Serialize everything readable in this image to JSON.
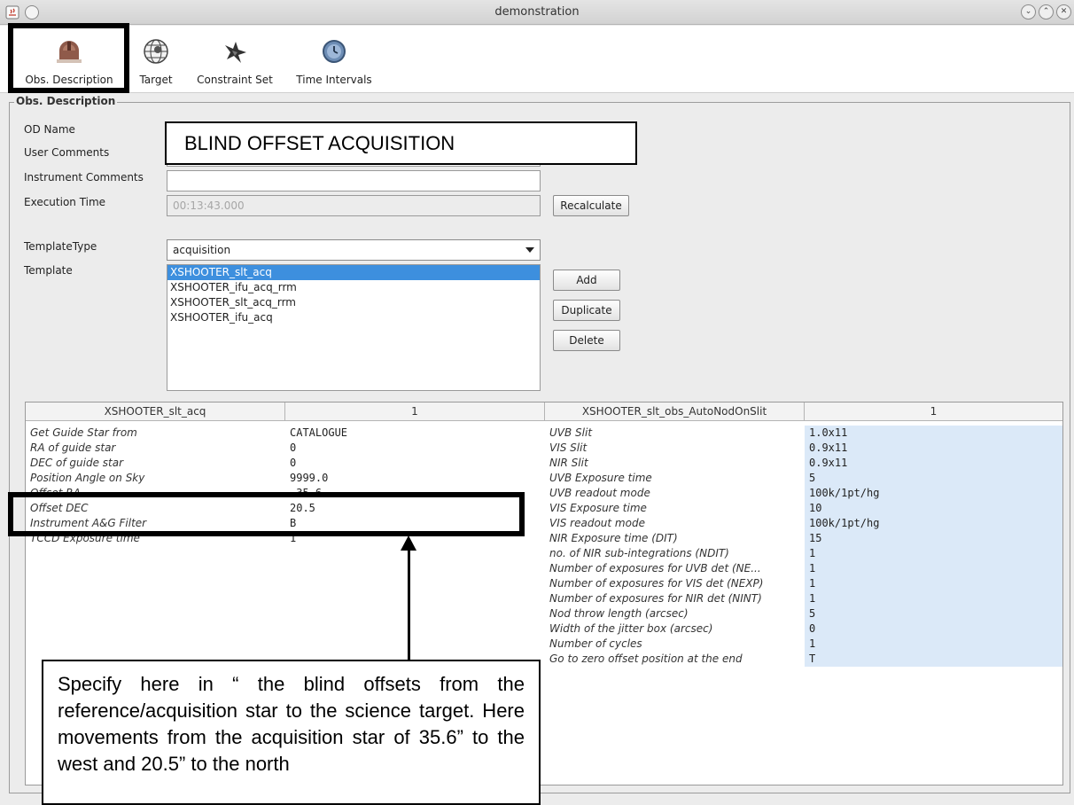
{
  "window": {
    "title": "demonstration",
    "controls": [
      "minimize",
      "maximize",
      "close"
    ]
  },
  "toolbar": {
    "tabs": [
      {
        "label": "Obs. Description",
        "icon": "telescope-dome-icon"
      },
      {
        "label": "Target",
        "icon": "globe-icon"
      },
      {
        "label": "Constraint Set",
        "icon": "star-icon"
      },
      {
        "label": "Time Intervals",
        "icon": "clock-icon"
      }
    ]
  },
  "obs": {
    "group_title": "Obs. Description",
    "labels": {
      "od_name": "OD Name",
      "user_comments": "User Comments",
      "instrument_comments": "Instrument Comments",
      "execution_time": "Execution Time",
      "template_type": "TemplateType",
      "template": "Template"
    },
    "od_name_value": "",
    "user_comments_value": "",
    "instrument_comments_value": "",
    "execution_time_value": "00:13:43.000",
    "recalculate_label": "Recalculate",
    "template_type_value": "acquisition",
    "templates": [
      "XSHOOTER_slt_acq",
      "XSHOOTER_ifu_acq_rrm",
      "XSHOOTER_slt_acq_rrm",
      "XSHOOTER_ifu_acq"
    ],
    "add_label": "Add",
    "duplicate_label": "Duplicate",
    "delete_label": "Delete"
  },
  "annotation": {
    "title_callout": "BLIND OFFSET ACQUISITION",
    "note": "Specify here in “ the blind offsets from the reference/acquisition star to the science target. Here movements from the acquisition star of 35.6” to the west and 20.5” to the north"
  },
  "params": {
    "headers": [
      "XSHOOTER_slt_acq",
      "1",
      "XSHOOTER_slt_obs_AutoNodOnSlit",
      "1"
    ],
    "left": [
      {
        "name": "Get Guide Star from",
        "value": "CATALOGUE"
      },
      {
        "name": "RA of guide star",
        "value": "0"
      },
      {
        "name": "DEC of guide star",
        "value": "0"
      },
      {
        "name": "Position Angle on Sky",
        "value": "9999.0"
      },
      {
        "name": "Offset RA",
        "value": "-35.6"
      },
      {
        "name": "Offset DEC",
        "value": "20.5"
      },
      {
        "name": "Instrument A&G Filter",
        "value": "B"
      },
      {
        "name": "TCCD Exposure time",
        "value": "1"
      }
    ],
    "right": [
      {
        "name": "UVB Slit",
        "value": "1.0x11"
      },
      {
        "name": "VIS Slit",
        "value": "0.9x11"
      },
      {
        "name": "NIR Slit",
        "value": "0.9x11"
      },
      {
        "name": "UVB Exposure time",
        "value": "5"
      },
      {
        "name": "UVB readout mode",
        "value": "100k/1pt/hg"
      },
      {
        "name": "VIS Exposure time",
        "value": "10"
      },
      {
        "name": "VIS readout mode",
        "value": "100k/1pt/hg"
      },
      {
        "name": "NIR Exposure time (DIT)",
        "value": "15"
      },
      {
        "name": "no. of NIR sub-integrations (NDIT)",
        "value": "1"
      },
      {
        "name": "Number of exposures for UVB det (NE...",
        "value": "1"
      },
      {
        "name": "Number of exposures for VIS det (NEXP)",
        "value": "1"
      },
      {
        "name": "Number of exposures for NIR det (NINT)",
        "value": "1"
      },
      {
        "name": "Nod throw length (arcsec)",
        "value": "5"
      },
      {
        "name": "Width of the jitter box (arcsec)",
        "value": "0"
      },
      {
        "name": "Number of cycles",
        "value": "1"
      },
      {
        "name": "Go to zero offset position at the end",
        "value": "T"
      }
    ]
  }
}
